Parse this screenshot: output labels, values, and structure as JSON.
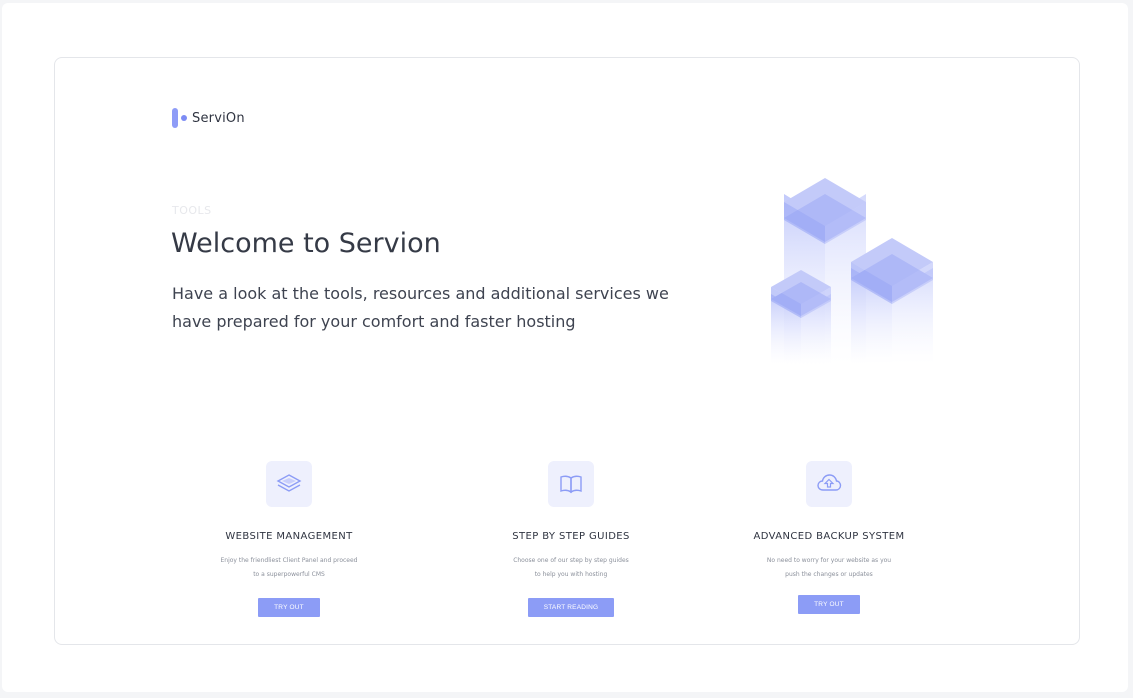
{
  "brand": {
    "name": "ServiOn"
  },
  "hero": {
    "eyebrow": "TOOLS",
    "title": "Welcome to Servion",
    "subtitle": "Have a look at the tools, resources and additional services we have prepared for your comfort and faster hosting"
  },
  "features": [
    {
      "icon": "layers-icon",
      "title": "WEBSITE MANAGEMENT",
      "desc_line1": "Enjoy the friendliest Client Panel and proceed",
      "desc_line2": "to a superpowerful CMS",
      "button": "TRY OUT"
    },
    {
      "icon": "book-icon",
      "title": "STEP BY STEP GUIDES",
      "desc_line1": "Choose one of our step by step guides",
      "desc_line2": "to help you with hosting",
      "button": "START READING"
    },
    {
      "icon": "cloud-upload-icon",
      "title": "ADVANCED BACKUP SYSTEM",
      "desc_line1": "No need to worry for your website as you",
      "desc_line2": "push the changes or updates",
      "button": "TRY OUT"
    }
  ],
  "colors": {
    "accent": "#8c9cf6",
    "icon_bg": "#eef0fd",
    "text_dark": "#353a46"
  }
}
